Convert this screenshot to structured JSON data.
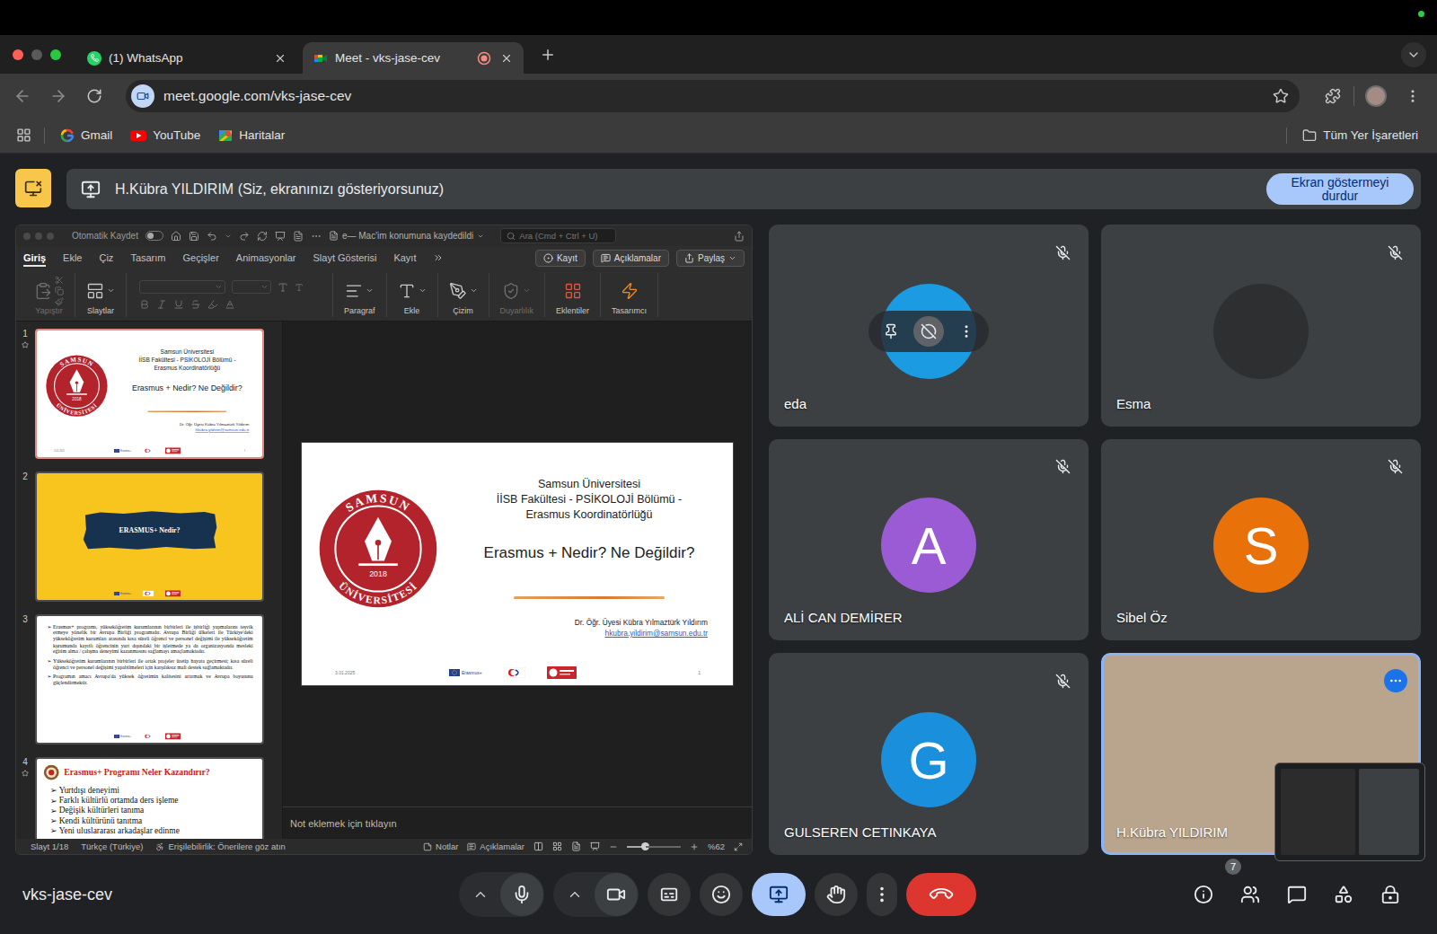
{
  "browser": {
    "tabs": [
      {
        "label": "(1) WhatsApp",
        "selected": false,
        "indicator": false,
        "kind": "whatsapp"
      },
      {
        "label": "Meet - vks-jase-cev",
        "selected": true,
        "indicator": true,
        "kind": "meet"
      }
    ],
    "url": "meet.google.com/vks-jase-cev",
    "bookmarks": [
      {
        "label": "Gmail",
        "kind": "google"
      },
      {
        "label": "YouTube",
        "kind": "youtube"
      },
      {
        "label": "Haritalar",
        "kind": "maps"
      }
    ],
    "all_bookmarks": "Tüm Yer İşaretleri"
  },
  "presenting_banner": {
    "text": "H.Kübra YILDIRIM (Siz, ekranınızı gösteriyorsunuz)",
    "button": "Ekran göstermeyi durdur"
  },
  "powerpoint": {
    "autosave_label": "Otomatik Kaydet",
    "autosave_on": false,
    "doc_status": "e— Mac'im konumuna kaydedildi",
    "search_placeholder": "Ara (Cmd + Ctrl + U)",
    "ribbon_tabs": [
      {
        "label": "Giriş",
        "selected": true
      },
      {
        "label": "Ekle",
        "selected": false
      },
      {
        "label": "Çiz",
        "selected": false
      },
      {
        "label": "Tasarım",
        "selected": false
      },
      {
        "label": "Geçişler",
        "selected": false
      },
      {
        "label": "Animasyonlar",
        "selected": false
      },
      {
        "label": "Slayt Gösterisi",
        "selected": false
      },
      {
        "label": "Kayıt",
        "selected": false
      }
    ],
    "actions": [
      {
        "label": "Kayıt",
        "kind": "record"
      },
      {
        "label": "Açıklamalar",
        "kind": "comments"
      },
      {
        "label": "Paylaş",
        "kind": "share"
      }
    ],
    "groups": [
      {
        "label": "Yapıştır",
        "kind": "paste",
        "disabled": true
      },
      {
        "label": "Slaytlar",
        "kind": "slides",
        "disabled": false
      },
      {
        "label": "",
        "kind": "font",
        "disabled": true
      },
      {
        "label": "Paragraf",
        "kind": "paragraph",
        "disabled": false
      },
      {
        "label": "Ekle",
        "kind": "insert",
        "disabled": false
      },
      {
        "label": "Çizim",
        "kind": "draw",
        "disabled": false
      },
      {
        "label": "Duyarlılık",
        "kind": "sensitivity",
        "disabled": true
      },
      {
        "label": "Eklentiler",
        "kind": "addins",
        "disabled": false
      },
      {
        "label": "Tasarımcı",
        "kind": "designer",
        "disabled": false
      }
    ],
    "thumbnails": [
      {
        "number": "1",
        "selected": true,
        "starred": true,
        "kind": "title"
      },
      {
        "number": "2",
        "selected": false,
        "starred": false,
        "kind": "section"
      },
      {
        "number": "3",
        "selected": false,
        "starred": false,
        "kind": "text"
      },
      {
        "number": "4",
        "selected": false,
        "starred": true,
        "kind": "list"
      }
    ],
    "title_slide": {
      "university": "Samsun Üniversitesi",
      "faculty": "İİSB Fakültesi - PSİKOLOJİ Bölümü -",
      "office": "Erasmus Koordinatörlüğü",
      "title": "Erasmus + Nedir? Ne Değildir?",
      "author": "Dr. Öğr. Üyesi Kübra Yılmaztürk Yıldırım",
      "email": "hkubra.yildirim@samsun.edu.tr",
      "date": "3.01.2025",
      "page": "1",
      "logo": {
        "top": "SAMSUN",
        "bottom": "ÜNİVERSİTESİ",
        "year": "2018"
      }
    },
    "section_slide": {
      "title": "ERASMUS+ Nedir?"
    },
    "text_slide": {
      "bullet": "➢",
      "paragraphs": [
        "Erasmus+ programı, yükseköğretim kurumlarının birbirleri ile işbirliği yapmalarını teşvik etmeye yönelik bir Avrupa Birliği programıdır. Avrupa Birliği ülkeleri ile Türkiye'deki yükseköğretim kurumları arasında kısa süreli öğrenci ve personel değişimi ile yükseköğretim kurumunda kayıtlı öğrencinin yurt dışındaki bir işletmede ya da organizasyonda mesleki eğitim alma / çalışma deneyimi kazanmasını sağlamayı amaçlamaktadır.",
        "Yükseköğretim kurumlarının birbirleri ile ortak projeler üretip hayata geçirmesi; kısa süreli öğrenci ve personel değişimi yapabilmeleri için karşılıksız mali destek sağlamaktadır.",
        "Programın amacı Avrupa'da yüksek öğretimin kalitesini artırmak ve Avrupa boyutunu güçlendirmektir."
      ]
    },
    "list_slide": {
      "bullet": "➢",
      "title": "Erasmus+ Programı Neler Kazandırır?",
      "items": [
        "Yurtdışı deneyimi",
        "Farklı kültürlü ortamda ders işleme",
        "Değişik kültürleri tanıma",
        "Kendi kültürünü tanıtma",
        "Yeni uluslararası arkadaşlar edinme"
      ]
    },
    "footer_logo_label": "Erasmus+",
    "notes_placeholder": "Not eklemek için tıklayın",
    "status": {
      "slide": "Slayt 1/18",
      "language": "Türkçe (Türkiye)",
      "accessibility": "Erişilebilirlik: Önerilere göz atın",
      "notes": "Notlar",
      "comments": "Açıklamalar",
      "zoom": "%62",
      "zoom_level": 0.33
    }
  },
  "participants": [
    {
      "name": "eda",
      "kind": "photo",
      "color": "#1b9be2",
      "muted": true,
      "hovered": true,
      "active": false
    },
    {
      "name": "Esma",
      "kind": "photo",
      "color": "#2e2f31",
      "muted": true,
      "hovered": false,
      "active": false
    },
    {
      "name": "ALİ CAN DEMİRER",
      "kind": "letter",
      "initial": "A",
      "color": "#9b5bd4",
      "muted": true,
      "hovered": false,
      "active": false
    },
    {
      "name": "Sibel Öz",
      "kind": "letter",
      "initial": "S",
      "color": "#e8710a",
      "muted": true,
      "hovered": false,
      "active": false
    },
    {
      "name": "GULSEREN CETINKAYA",
      "kind": "letter",
      "initial": "G",
      "color": "#1a8fdb",
      "muted": true,
      "hovered": false,
      "active": false
    },
    {
      "name": "H.Kübra YILDIRIM",
      "kind": "video",
      "color": "#b9a58d",
      "muted": false,
      "hovered": false,
      "active": true
    }
  ],
  "meeting_code": "vks-jase-cev",
  "controls": [
    {
      "kind": "mic",
      "muted": false
    },
    {
      "kind": "camera",
      "off": false
    },
    {
      "kind": "captions",
      "on": false
    },
    {
      "kind": "reactions"
    },
    {
      "kind": "present",
      "active": true
    },
    {
      "kind": "hand",
      "raised": false
    },
    {
      "kind": "more"
    },
    {
      "kind": "leave"
    }
  ],
  "side_controls": [
    {
      "kind": "info"
    },
    {
      "kind": "people",
      "badge": "7"
    },
    {
      "kind": "chat"
    },
    {
      "kind": "activities"
    },
    {
      "kind": "host"
    }
  ]
}
